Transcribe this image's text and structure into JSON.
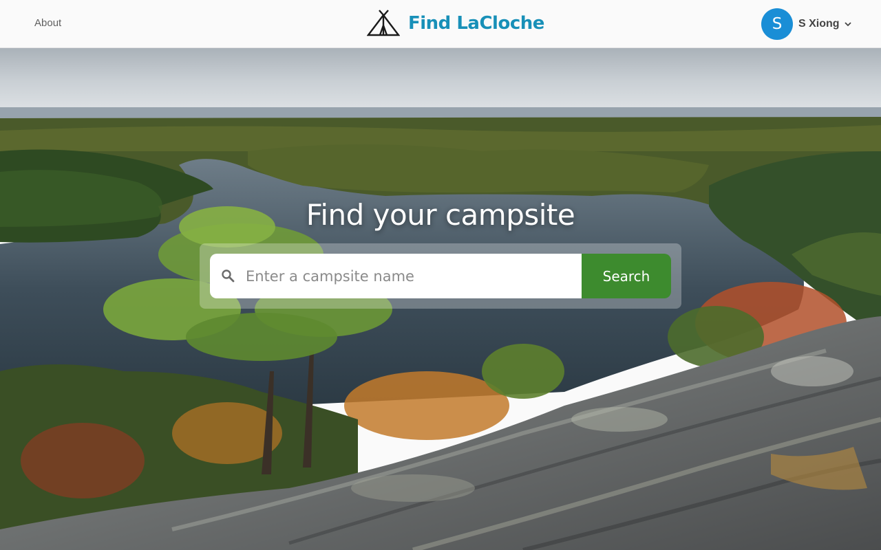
{
  "header": {
    "about_label": "About",
    "brand_name": "Find LaCloche",
    "brand_logo_icon": "tent-icon",
    "user": {
      "avatar_initial": "S",
      "name": "S Xiong",
      "menu_icon": "chevron-down-icon"
    }
  },
  "hero": {
    "title": "Find your campsite",
    "search": {
      "placeholder": "Enter a campsite name",
      "value": "",
      "icon": "search-icon",
      "button_label": "Search"
    }
  },
  "colors": {
    "brand": "#1890b8",
    "avatar": "#1a8ed6",
    "search_button": "#3d8b2e"
  }
}
